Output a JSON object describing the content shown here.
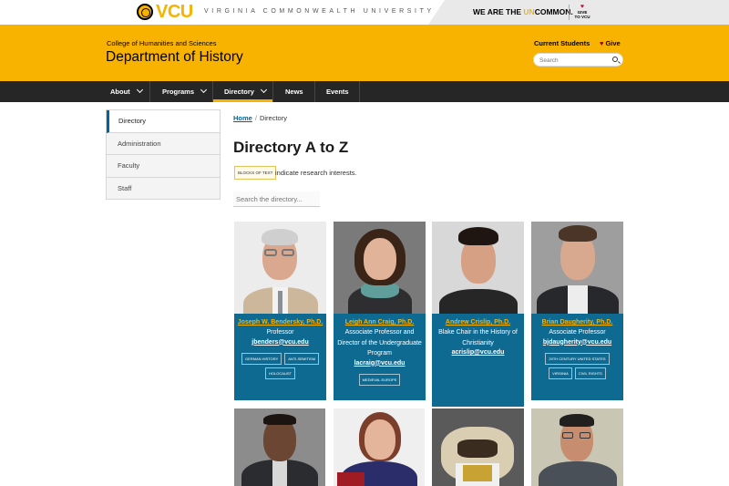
{
  "topbar": {
    "logo": "VCU",
    "university": "VIRGINIA COMMONWEALTH UNIVERSITY",
    "tagline_pre": "WE ARE THE ",
    "tagline_accent": "UN",
    "tagline_post": "COMMON.",
    "give_line1": "GIVE",
    "give_line2": "TO VCU"
  },
  "header": {
    "college": "College of Humanities and Sciences",
    "department": "Department of History",
    "current_students": "Current Students",
    "give": "Give",
    "search_placeholder": "Search"
  },
  "nav": {
    "items": [
      {
        "label": "About",
        "dropdown": true
      },
      {
        "label": "Programs",
        "dropdown": true
      },
      {
        "label": "Directory",
        "dropdown": true,
        "active": true
      },
      {
        "label": "News",
        "dropdown": false
      },
      {
        "label": "Events",
        "dropdown": false
      }
    ]
  },
  "sidebar": {
    "items": [
      {
        "label": "Directory",
        "active": true
      },
      {
        "label": "Administration"
      },
      {
        "label": "Faculty"
      },
      {
        "label": "Staff"
      }
    ]
  },
  "breadcrumb": {
    "home": "Home",
    "separator": "/",
    "current": "Directory"
  },
  "main": {
    "title": "Directory A to Z",
    "legend_tag": "BLOCKS OF TEXT",
    "legend_text": "indicate research interests.",
    "search_placeholder": "Search the directory..."
  },
  "people": [
    {
      "name": "Joseph W. Bendersky, Ph.D.",
      "title": "Professor",
      "email": "jbenders@vcu.edu",
      "tags": [
        "GERMAN HISTORY",
        "ANTI-SEMITISM",
        "HOLOCAUST"
      ]
    },
    {
      "name": "Leigh Ann Craig, Ph.D.",
      "title": "Associate Professor and Director of the Undergraduate Program",
      "email": "lacraig@vcu.edu",
      "tags": [
        "MEDIEVAL EUROPE"
      ]
    },
    {
      "name": "Andrew Crislip, Ph.D.",
      "title": "Blake Chair in the History of Christianity",
      "email": "acrislip@vcu.edu",
      "tags": []
    },
    {
      "name": "Brian Daugherity, Ph.D.",
      "title": "Associate Professor",
      "email": "bjdaugherity@vcu.edu",
      "tags": [
        "20TH CENTURY UNITED STATES",
        "VIRGINIA",
        "CIVIL RIGHTS"
      ]
    }
  ],
  "colors": {
    "gold": "#f8b300",
    "nav": "#262626",
    "card": "#0f6a92",
    "link": "#006699"
  }
}
